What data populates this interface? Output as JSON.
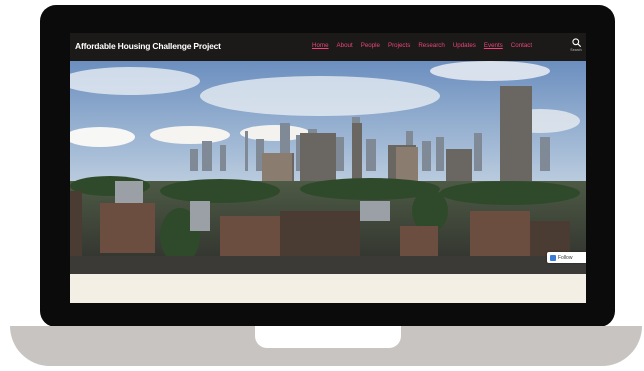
{
  "site": {
    "title": "Affordable Housing Challenge Project"
  },
  "nav": {
    "items": [
      {
        "label": "Home",
        "active": true
      },
      {
        "label": "About",
        "active": false
      },
      {
        "label": "People",
        "active": false
      },
      {
        "label": "Projects",
        "active": false
      },
      {
        "label": "Research",
        "active": false
      },
      {
        "label": "Updates",
        "active": false
      },
      {
        "label": "Events",
        "active": true
      },
      {
        "label": "Contact",
        "active": false
      }
    ]
  },
  "search": {
    "label": "Search",
    "icon": "search-icon"
  },
  "follow": {
    "label": "Follow",
    "icon": "follow-icon"
  },
  "colors": {
    "header_bg": "#1c1a19",
    "nav_link": "#e8457a",
    "title_text": "#ffffff",
    "content_bg": "#f4efe4",
    "laptop_body": "#0b0b0b",
    "laptop_base": "#c8c4c1"
  }
}
